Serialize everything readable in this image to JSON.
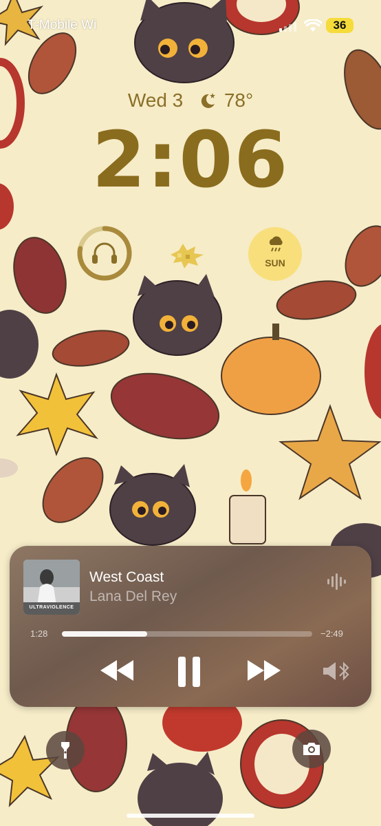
{
  "status_bar": {
    "carrier": "T-Mobile Wi",
    "battery": "36"
  },
  "lock": {
    "date": "Wed 3",
    "temperature": "78°",
    "time": "2:06"
  },
  "widgets": {
    "weather_label": "SUN",
    "ring_progress": 0.78
  },
  "now_playing": {
    "title": "West Coast",
    "artist": "Lana Del Rey",
    "album_caption": "ULTRAVIOLENCE",
    "elapsed": "1:28",
    "remaining": "−2:49",
    "progress": 0.34
  },
  "colors": {
    "accent": "#8a6c1e",
    "battery": "#f5dc3a",
    "background": "#f6ecc8"
  }
}
